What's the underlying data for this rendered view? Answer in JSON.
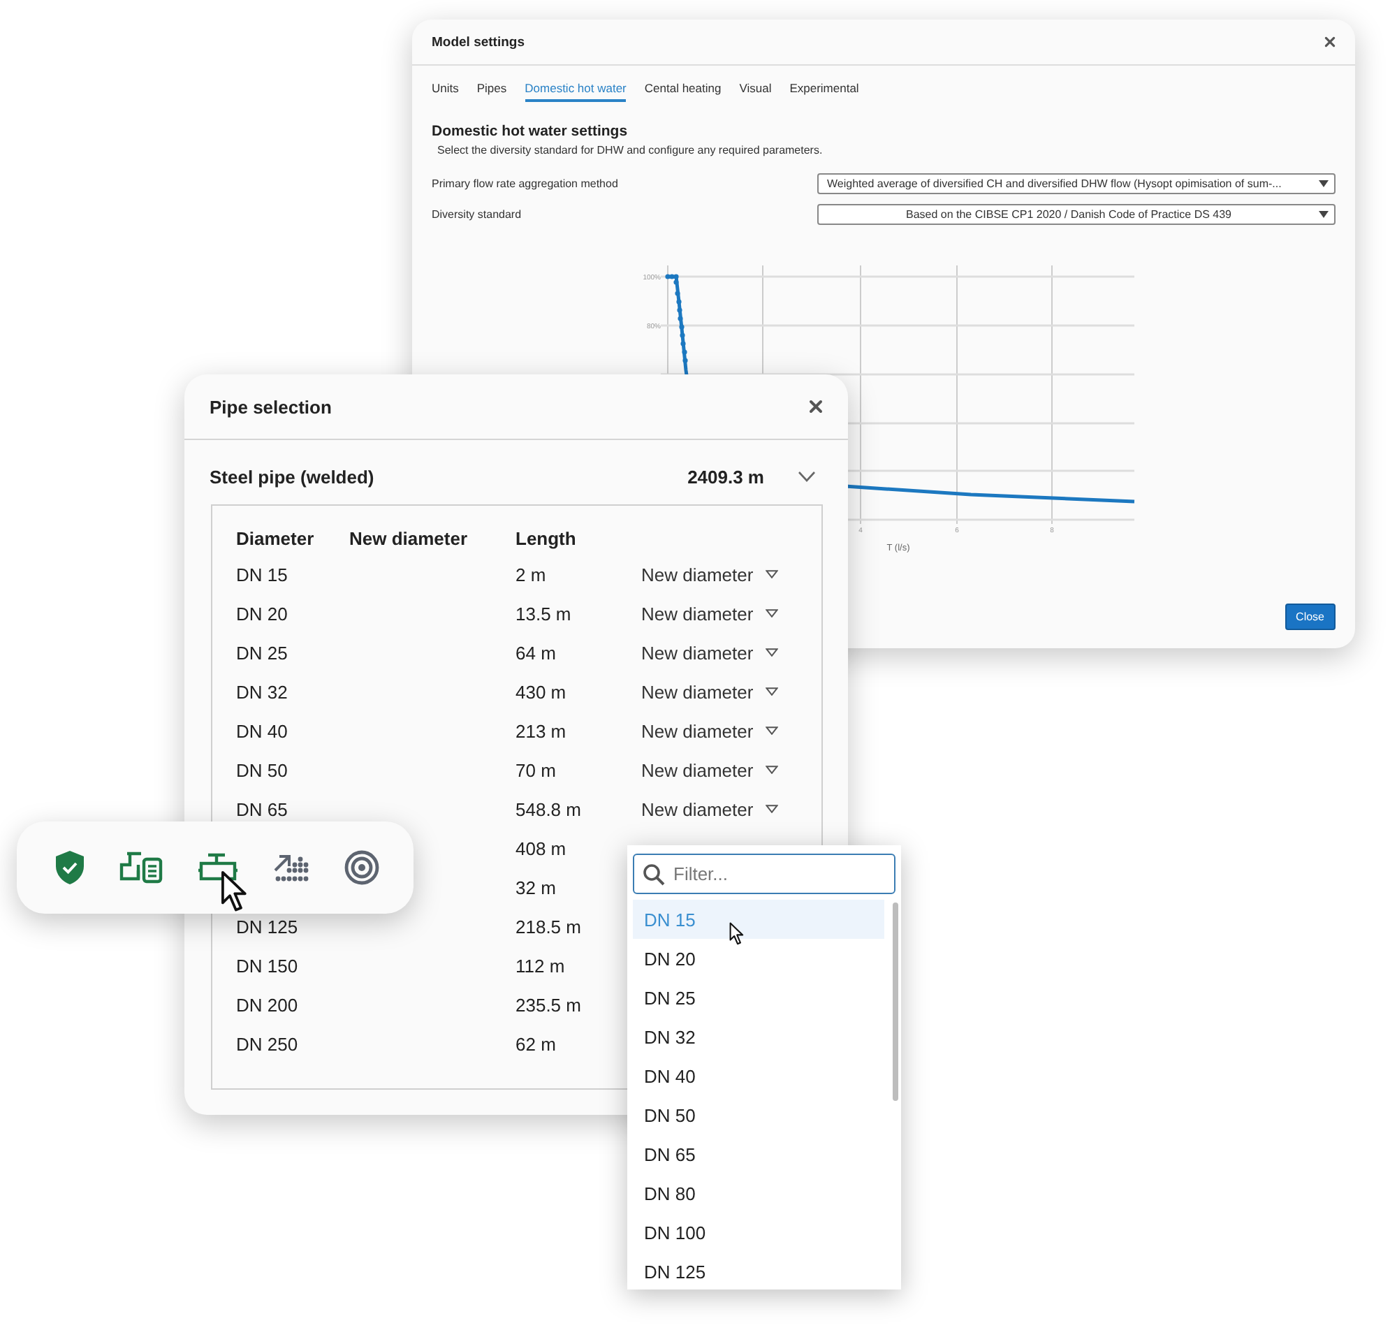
{
  "model_settings": {
    "title": "Model settings",
    "tabs": [
      {
        "label": "Units",
        "selected": false
      },
      {
        "label": "Pipes",
        "selected": false
      },
      {
        "label": "Domestic hot water",
        "selected": true
      },
      {
        "label": "Cental heating",
        "selected": false
      },
      {
        "label": "Visual",
        "selected": false
      },
      {
        "label": "Experimental",
        "selected": false
      }
    ],
    "heading": "Domestic hot water settings",
    "description": "Select the diversity standard for DHW and configure any required parameters.",
    "fields": [
      {
        "label": "Primary flow rate aggregation method",
        "value": "Weighted average of diversified CH and diversified DHW flow (Hysopt opimisation of sum-...",
        "centered": false
      },
      {
        "label": "Diversity standard",
        "value": "Based on the CIBSE CP1 2020 / Danish Code of Practice DS 439",
        "centered": true
      }
    ],
    "chart": {
      "y_tick_labels": [
        "100%",
        "80%"
      ],
      "x_tick_labels": [
        "4",
        "6",
        "8"
      ],
      "x_axis_title": "T (l/s)"
    },
    "close_button": "Close"
  },
  "pipe_selection": {
    "title": "Pipe selection",
    "group": {
      "name": "Steel pipe (welded)",
      "total": "2409.3 m",
      "expanded": true
    },
    "columns": [
      "Diameter",
      "New diameter",
      "Length"
    ],
    "rows": [
      {
        "diameter": "DN 15",
        "length": "2 m",
        "new_diameter": "New diameter"
      },
      {
        "diameter": "DN 20",
        "length": "13.5 m",
        "new_diameter": "New diameter"
      },
      {
        "diameter": "DN 25",
        "length": "64 m",
        "new_diameter": "New diameter"
      },
      {
        "diameter": "DN 32",
        "length": "430 m",
        "new_diameter": "New diameter"
      },
      {
        "diameter": "DN 40",
        "length": "213 m",
        "new_diameter": "New diameter"
      },
      {
        "diameter": "DN 50",
        "length": "70 m",
        "new_diameter": "New diameter"
      },
      {
        "diameter": "DN 65",
        "length": "548.8 m",
        "new_diameter": "New diameter"
      },
      {
        "length": "408 m"
      },
      {
        "length": "32 m"
      },
      {
        "diameter": "DN 125",
        "length": "218.5 m"
      },
      {
        "diameter": "DN 150",
        "length": "112 m"
      },
      {
        "diameter": "DN 200",
        "length": "235.5 m"
      },
      {
        "diameter": "DN 250",
        "length": "62 m"
      }
    ]
  },
  "toolbar": {
    "tools": [
      {
        "kind": "shield",
        "highlighted": true
      },
      {
        "kind": "pipe-document",
        "highlighted": true
      },
      {
        "kind": "pipe",
        "highlighted": true
      },
      {
        "kind": "arrow-dots",
        "highlighted": false
      },
      {
        "kind": "target",
        "highlighted": false
      }
    ]
  },
  "dropdown": {
    "filter_placeholder": "Filter...",
    "options": [
      {
        "label": "DN 15",
        "selected": true
      },
      {
        "label": "DN 20",
        "selected": false
      },
      {
        "label": "DN 25",
        "selected": false
      },
      {
        "label": "DN 32",
        "selected": false
      },
      {
        "label": "DN 40",
        "selected": false
      },
      {
        "label": "DN 50",
        "selected": false
      },
      {
        "label": "DN 65",
        "selected": false
      },
      {
        "label": "DN 80",
        "selected": false
      },
      {
        "label": "DN 100",
        "selected": false
      },
      {
        "label": "DN 125",
        "selected": false
      }
    ]
  }
}
